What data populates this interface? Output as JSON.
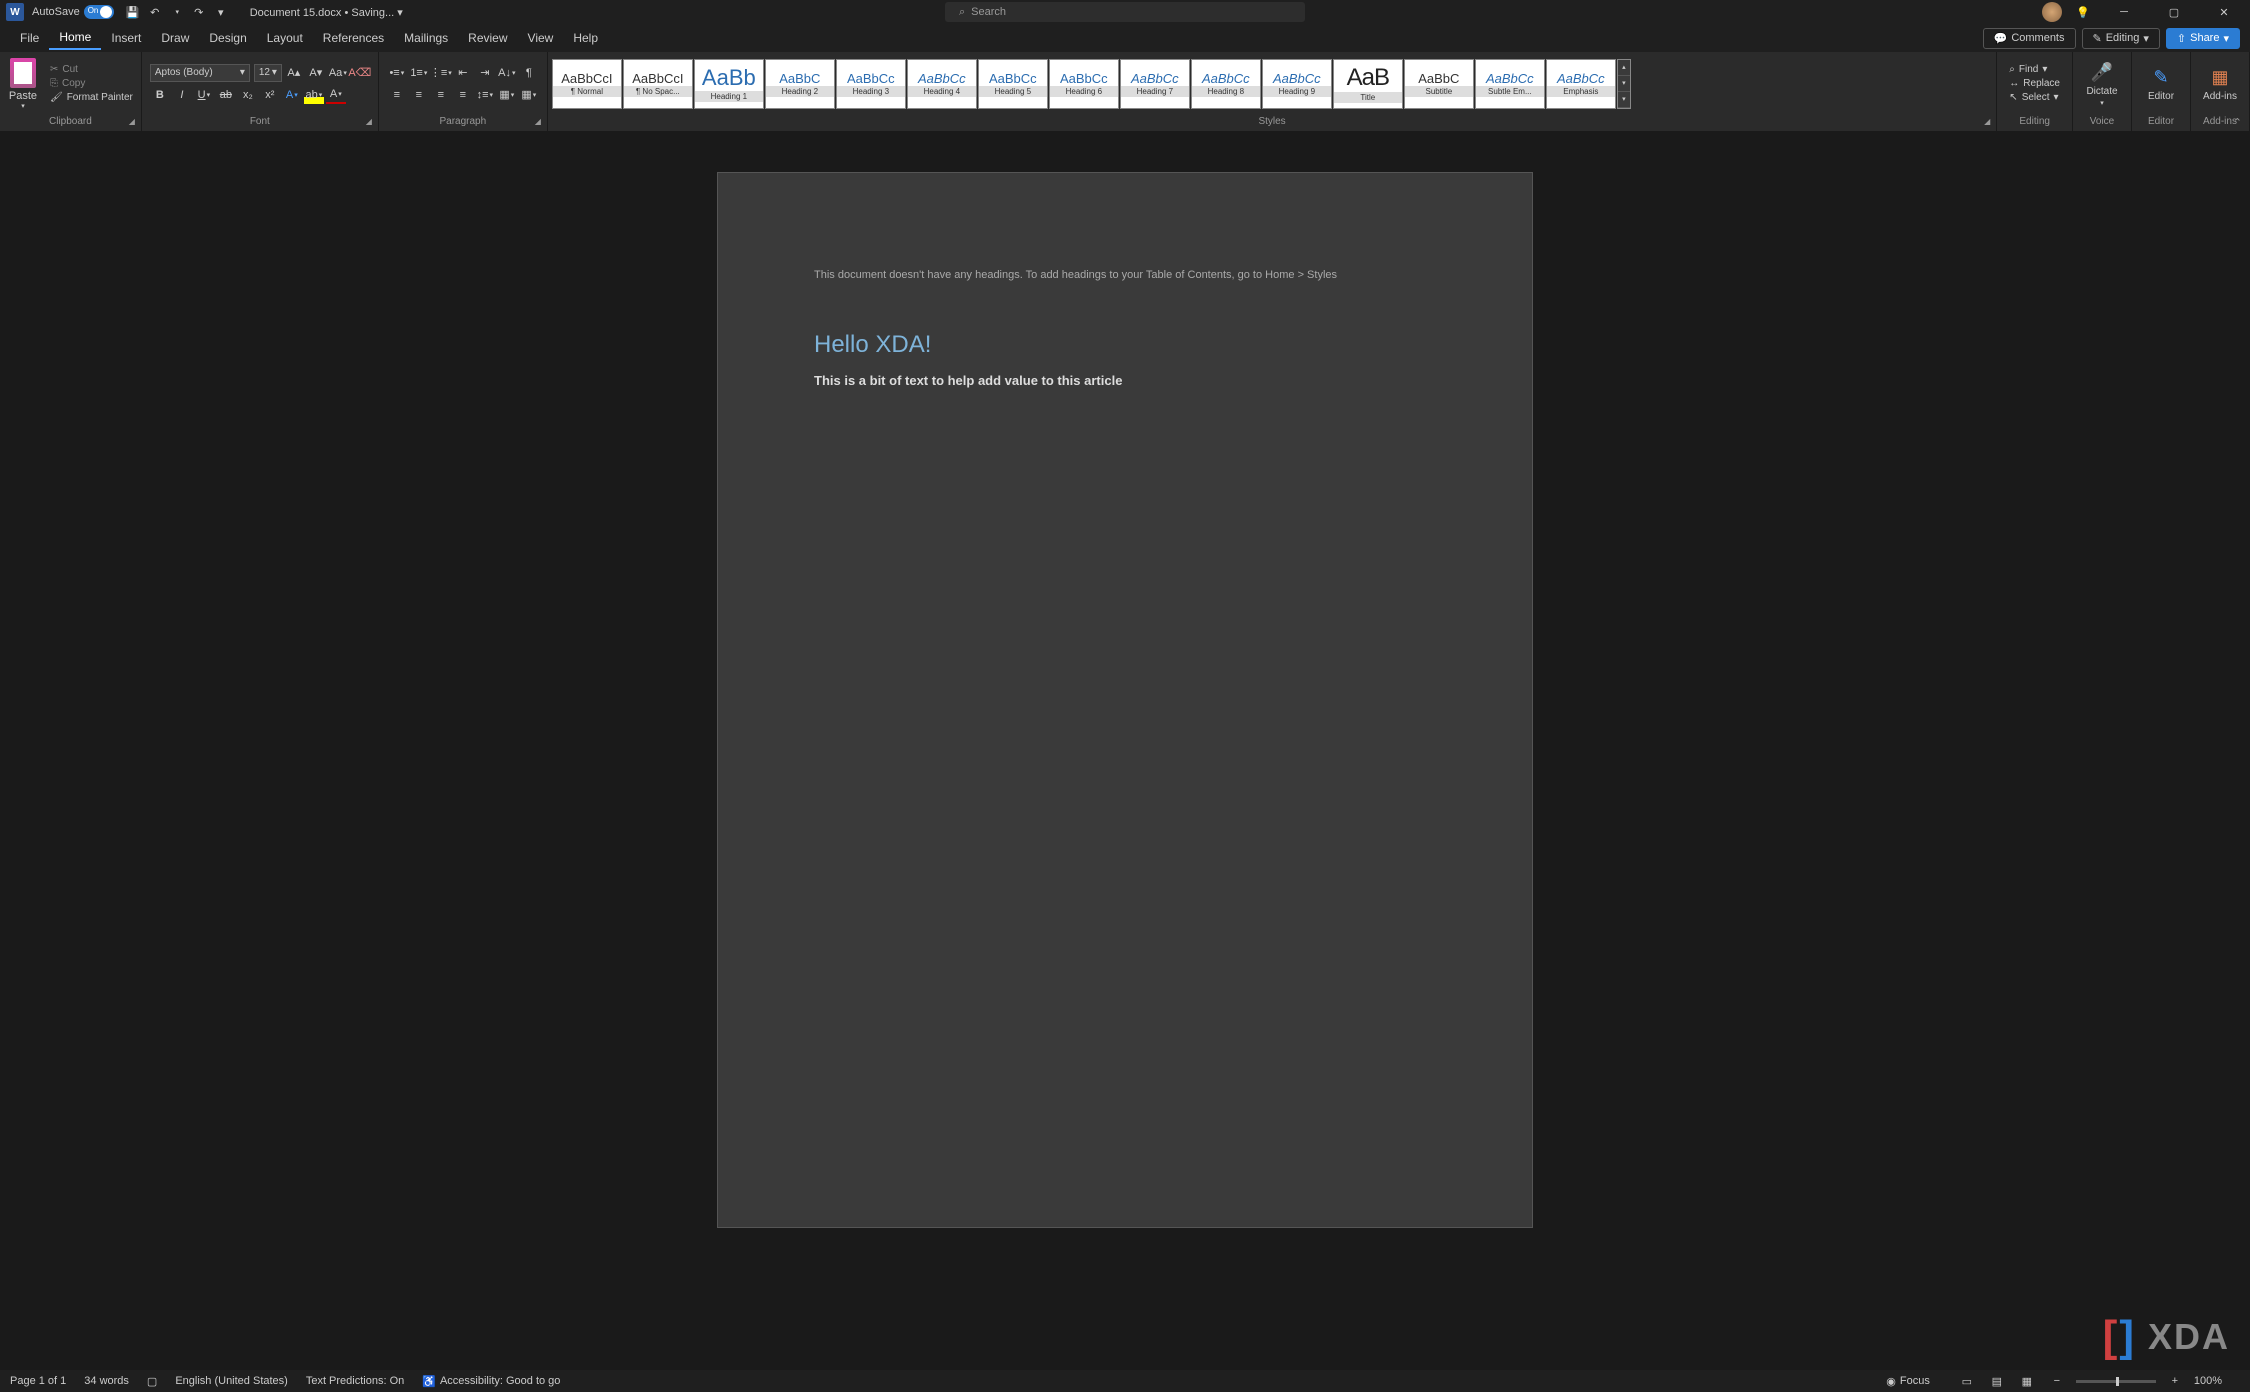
{
  "titlebar": {
    "autosave_label": "AutoSave",
    "autosave_state": "On",
    "doc_name": "Document 15.docx",
    "doc_status": "Saving...",
    "search_placeholder": "Search"
  },
  "tabs": {
    "file": "File",
    "home": "Home",
    "insert": "Insert",
    "draw": "Draw",
    "design": "Design",
    "layout": "Layout",
    "references": "References",
    "mailings": "Mailings",
    "review": "Review",
    "view": "View",
    "help": "Help",
    "comments": "Comments",
    "editing": "Editing",
    "share": "Share"
  },
  "ribbon": {
    "clipboard": {
      "label": "Clipboard",
      "paste": "Paste",
      "cut": "Cut",
      "copy": "Copy",
      "format_painter": "Format Painter"
    },
    "font": {
      "label": "Font",
      "name": "Aptos (Body)",
      "size": "12"
    },
    "paragraph": {
      "label": "Paragraph"
    },
    "styles": {
      "label": "Styles",
      "items": [
        {
          "preview": "AaBbCcI",
          "name": "¶ Normal",
          "cls": ""
        },
        {
          "preview": "AaBbCcI",
          "name": "¶ No Spac...",
          "cls": ""
        },
        {
          "preview": "AaBb",
          "name": "Heading 1",
          "cls": "big"
        },
        {
          "preview": "AaBbC",
          "name": "Heading 2",
          "cls": "blue"
        },
        {
          "preview": "AaBbCc",
          "name": "Heading 3",
          "cls": "blue"
        },
        {
          "preview": "AaBbCc",
          "name": "Heading 4",
          "cls": "italic"
        },
        {
          "preview": "AaBbCc",
          "name": "Heading 5",
          "cls": "blue"
        },
        {
          "preview": "AaBbCc",
          "name": "Heading 6",
          "cls": "blue"
        },
        {
          "preview": "AaBbCc",
          "name": "Heading 7",
          "cls": "italic"
        },
        {
          "preview": "AaBbCc",
          "name": "Heading 8",
          "cls": "italic"
        },
        {
          "preview": "AaBbCc",
          "name": "Heading 9",
          "cls": "italic"
        },
        {
          "preview": "AaB",
          "name": "Title",
          "cls": "title"
        },
        {
          "preview": "AaBbC",
          "name": "Subtitle",
          "cls": ""
        },
        {
          "preview": "AaBbCc",
          "name": "Subtle Em...",
          "cls": "italic"
        },
        {
          "preview": "AaBbCc",
          "name": "Emphasis",
          "cls": "italic"
        }
      ]
    },
    "editing": {
      "label": "Editing",
      "find": "Find",
      "replace": "Replace",
      "select": "Select"
    },
    "voice": {
      "label": "Voice",
      "dictate": "Dictate"
    },
    "editor": {
      "label": "Editor",
      "editor": "Editor"
    },
    "addins": {
      "label": "Add-ins",
      "addins": "Add-ins"
    }
  },
  "document": {
    "toc_message": "This document doesn't have any headings. To add headings to your Table of Contents, go to Home > Styles",
    "heading": "Hello XDA!",
    "body": "This is a bit of text to help add value to this article"
  },
  "statusbar": {
    "page": "Page 1 of 1",
    "words": "34 words",
    "language": "English (United States)",
    "predictions": "Text Predictions: On",
    "accessibility": "Accessibility: Good to go",
    "focus": "Focus",
    "zoom": "100%"
  },
  "watermark": "XDA"
}
